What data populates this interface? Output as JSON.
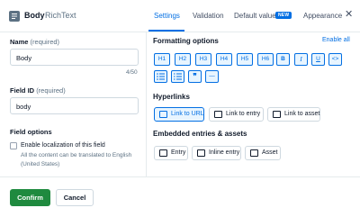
{
  "header": {
    "field_name": "Body",
    "field_type": "RichText",
    "tabs": [
      {
        "label": "Settings",
        "active": true
      },
      {
        "label": "Validation",
        "active": false
      },
      {
        "label": "Default value",
        "active": false,
        "badge": "NEW"
      },
      {
        "label": "Appearance",
        "active": false
      }
    ],
    "close_icon": "close-icon",
    "field_icon": "richtext-icon"
  },
  "left": {
    "name_label": "Name",
    "name_req": "(required)",
    "name_value": "Body",
    "name_counter": "4/50",
    "id_label": "Field ID",
    "id_req": "(required)",
    "id_value": "body",
    "options_label": "Field options",
    "localization_label": "Enable localization of this field",
    "localization_checked": false,
    "localization_help": "All the content can be translated to English (United States)"
  },
  "formatting": {
    "title": "Formatting options",
    "enable_all": "Enable all",
    "row1": [
      "H1",
      "H2",
      "H3",
      "H4",
      "H5",
      "H6",
      "B",
      "I",
      "U",
      "<>"
    ],
    "row2_icons": [
      "bullet-list-icon",
      "numbered-list-icon",
      "quote-icon",
      "horizontal-rule-icon"
    ]
  },
  "hyperlinks": {
    "title": "Hyperlinks",
    "items": [
      {
        "label": "Link to URL",
        "active": true,
        "icon": "link-url-icon"
      },
      {
        "label": "Link to entry",
        "active": false,
        "icon": "link-entry-icon"
      },
      {
        "label": "Link to asset",
        "active": false,
        "icon": "link-asset-icon"
      }
    ]
  },
  "embedded": {
    "title": "Embedded entries & assets",
    "items": [
      {
        "label": "Entry",
        "icon": "entry-icon"
      },
      {
        "label": "Inline entry",
        "icon": "inline-entry-icon"
      },
      {
        "label": "Asset",
        "icon": "asset-icon"
      }
    ]
  },
  "footer": {
    "confirm": "Confirm",
    "cancel": "Cancel"
  },
  "colors": {
    "accent": "#036fe3",
    "confirm": "#1f8a3f",
    "text": "#111b2b",
    "muted": "#5c7183"
  }
}
